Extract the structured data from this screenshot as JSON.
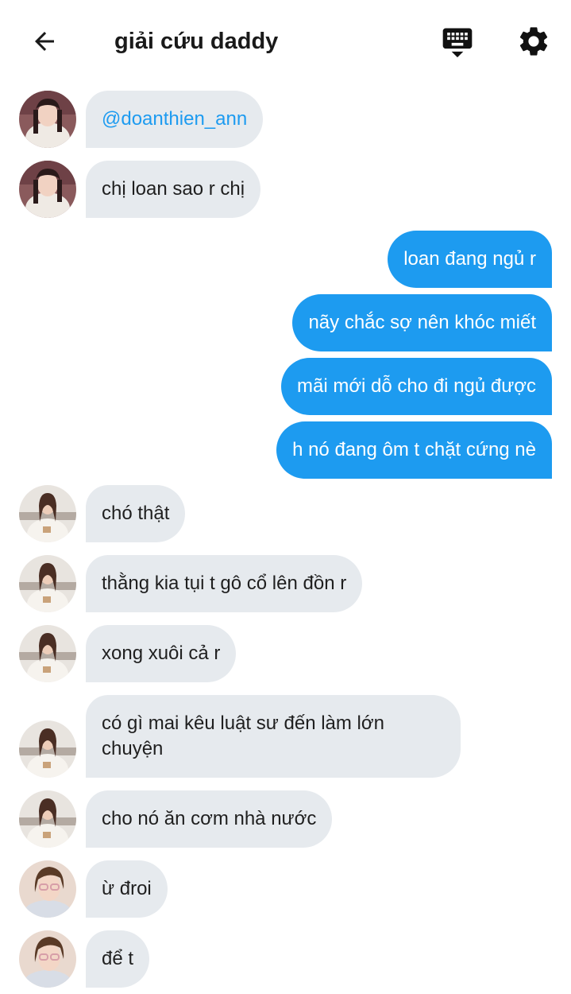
{
  "header": {
    "title": "giải cứu daddy",
    "back_icon": "arrow-left-icon",
    "keyboard_icon": "keyboard-icon",
    "settings_icon": "gear-icon"
  },
  "colors": {
    "outgoing_bubble": "#1d9bf0",
    "incoming_bubble": "#e6eaee",
    "mention": "#1d9bf0"
  },
  "messages": [
    {
      "side": "incoming",
      "sender_avatar": "avatar-a",
      "text": "@doanthien_ann",
      "is_mention": true
    },
    {
      "side": "incoming",
      "sender_avatar": "avatar-a",
      "text": "chị loan sao r chị"
    },
    {
      "side": "outgoing",
      "text": "loan đang ngủ r"
    },
    {
      "side": "outgoing",
      "text": "nãy chắc sợ nên khóc miết"
    },
    {
      "side": "outgoing",
      "text": "mãi mới dỗ cho đi ngủ được"
    },
    {
      "side": "outgoing",
      "text": "h nó đang ôm t chặt cứng nè"
    },
    {
      "side": "incoming",
      "sender_avatar": "avatar-b",
      "text": "chó thật"
    },
    {
      "side": "incoming",
      "sender_avatar": "avatar-b",
      "text": "thằng kia tụi t gô cổ lên đồn r"
    },
    {
      "side": "incoming",
      "sender_avatar": "avatar-b",
      "text": "xong xuôi cả r"
    },
    {
      "side": "incoming",
      "sender_avatar": "avatar-b",
      "text": "có gì mai kêu luật sư đến làm lớn chuyện"
    },
    {
      "side": "incoming",
      "sender_avatar": "avatar-b",
      "text": "cho nó ăn cơm nhà nước"
    },
    {
      "side": "incoming",
      "sender_avatar": "avatar-c",
      "text": "ừ đroi"
    },
    {
      "side": "incoming",
      "sender_avatar": "avatar-c",
      "text": "để t"
    }
  ]
}
